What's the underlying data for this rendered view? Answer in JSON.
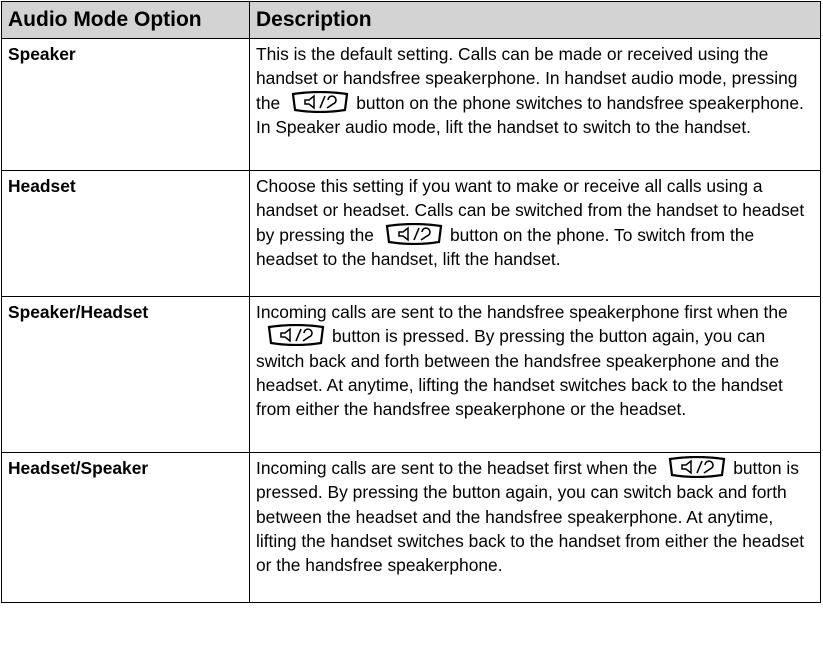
{
  "table": {
    "headers": [
      "Audio Mode Option",
      "Description"
    ],
    "rows": [
      {
        "option": "Speaker",
        "desc_before": "This is the default setting. Calls can be made or received using the handset or handsfree speakerphone. In handset audio mode, pressing the",
        "desc_after": "button on the phone switches to handsfree speakerphone. In Speaker audio mode, lift the handset to switch to the handset."
      },
      {
        "option": "Headset",
        "desc_before": "Choose this setting if you want to make or receive all calls using a handset or headset. Calls can be switched from the handset to headset by pressing the",
        "desc_after": "button on the phone. To switch from the headset to the handset, lift the handset."
      },
      {
        "option": "Speaker/Headset",
        "desc_before": "Incoming calls are sent to the handsfree speakerphone first when the",
        "desc_after": "button is pressed. By pressing the button again, you can switch back and forth between the handsfree speakerphone and the headset. At anytime, lifting the handset switches back to the handset from either the handsfree speakerphone or the headset."
      },
      {
        "option": "Headset/Speaker",
        "desc_before": "Incoming calls are sent to the headset first when the",
        "desc_after": "button is pressed. By pressing the button again, you can switch back and forth between the headset and the handsfree speakerphone. At anytime, lifting the handset switches back to the handset from either the headset or the handsfree speakerphone."
      }
    ],
    "icon": "speaker-headset-button-icon"
  }
}
